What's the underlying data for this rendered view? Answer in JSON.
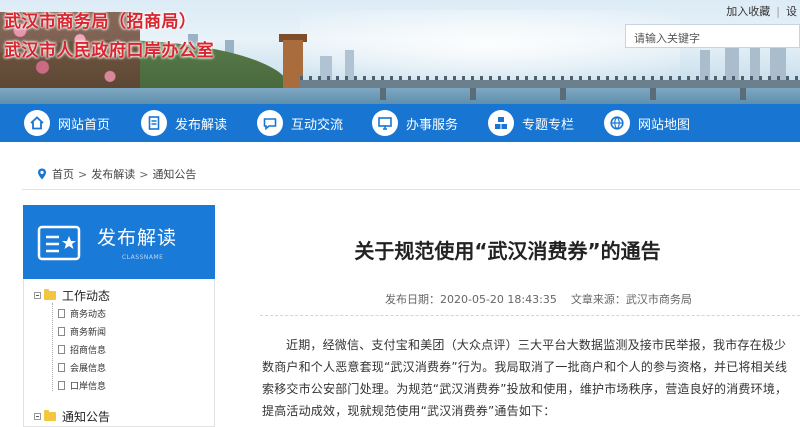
{
  "header": {
    "title_line1": "武汉市商务局（招商局）",
    "title_line2": "武汉市人民政府口岸办公室",
    "links": [
      "加入收藏",
      "设"
    ],
    "search_placeholder": "请输入关键字"
  },
  "nav": {
    "items": [
      {
        "label": "网站首页",
        "icon": "home-icon"
      },
      {
        "label": "发布解读",
        "icon": "document-icon"
      },
      {
        "label": "互动交流",
        "icon": "chat-icon"
      },
      {
        "label": "办事服务",
        "icon": "monitor-icon"
      },
      {
        "label": "专题专栏",
        "icon": "cubes-icon"
      },
      {
        "label": "网站地图",
        "icon": "globe-icon"
      }
    ]
  },
  "breadcrumb": {
    "items": [
      "首页",
      "发布解读",
      "通知公告"
    ],
    "separator": ">"
  },
  "sidebar": {
    "title": "发布解读",
    "subtitle": "CLASSNAME",
    "sections": [
      {
        "label": "工作动态",
        "children": [
          "商务动态",
          "商务新闻",
          "招商信息",
          "会展信息",
          "口岸信息"
        ]
      },
      {
        "label": "通知公告",
        "children": []
      }
    ]
  },
  "article": {
    "title": "关于规范使用“武汉消费券”的通告",
    "date": "发布日期：2020-05-20 18:43:35",
    "source": "文章来源：武汉市商务局",
    "body": "近期，经微信、支付宝和美团（大众点评）三大平台大数据监测及接市民举报，我市存在极少数商户和个人恶意套现“武汉消费券”行为。我局取消了一批商户和个人的参与资格，并已将相关线索移交市公安部门处理。为规范“武汉消费券”投放和使用，维护市场秩序，营造良好的消费环境，提高活动成效，现就规范使用“武汉消费券”通告如下："
  },
  "colors": {
    "nav_blue": "#1876d2",
    "title_red": "#d8252e",
    "sidebar_blue": "#1a7ad8"
  }
}
